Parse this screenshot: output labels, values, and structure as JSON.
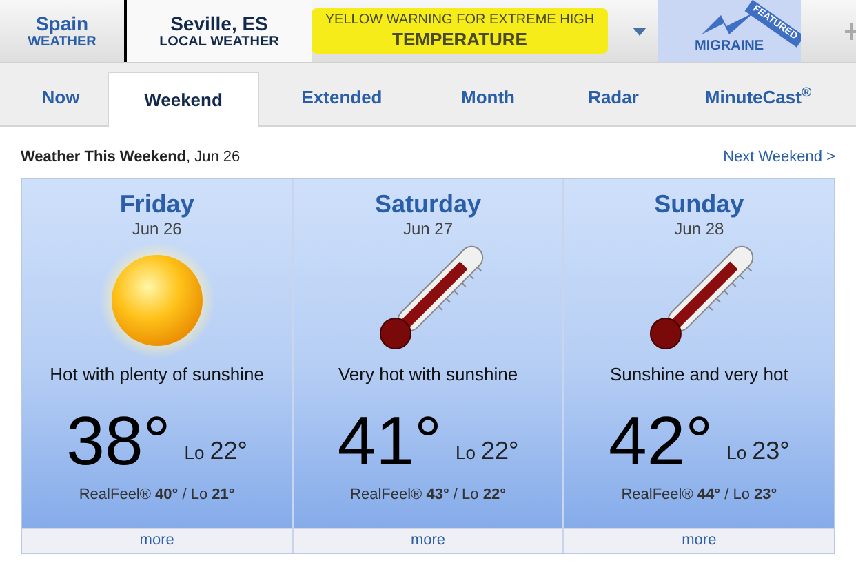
{
  "header": {
    "country": {
      "name": "Spain",
      "sub": "WEATHER"
    },
    "city": {
      "name": "Seville, ES",
      "sub": "LOCAL WEATHER"
    },
    "warning": {
      "line1": "YELLOW WARNING FOR EXTREME HIGH",
      "line2": "TEMPERATURE"
    },
    "featured": {
      "badge": "FEATURED",
      "label": "MIGRAINE"
    }
  },
  "tabs": [
    {
      "label": "Now",
      "selected": false
    },
    {
      "label": "Weekend",
      "selected": true
    },
    {
      "label": "Extended",
      "selected": false
    },
    {
      "label": "Month",
      "selected": false
    },
    {
      "label": "Radar",
      "selected": false
    },
    {
      "label": "MinuteCast$^{®}$",
      "selected": false
    }
  ],
  "section": {
    "title": "Weather This Weekend",
    "date": ", Jun 26",
    "link": "Next Weekend >"
  },
  "days": [
    {
      "name": "Friday",
      "date": "Jun 26",
      "kind": "sun",
      "summary": "Hot with plenty of sunshine",
      "high": "38°",
      "lo_label": "Lo",
      "low": "22°",
      "realfeel": "RealFeel® **40°** / Lo **21°**",
      "more": "more"
    },
    {
      "name": "Saturday",
      "date": "Jun 27",
      "kind": "thermometer",
      "summary": "Very hot with sunshine",
      "high": "41°",
      "lo_label": "Lo",
      "low": "22°",
      "realfeel": "RealFeel® **43°** / Lo **22°**",
      "more": "more"
    },
    {
      "name": "Sunday",
      "date": "Jun 28",
      "kind": "thermometer",
      "summary": "Sunshine and very hot",
      "high": "42°",
      "lo_label": "Lo",
      "low": "23°",
      "realfeel": "RealFeel® **44°** / Lo **23°**",
      "more": "more"
    }
  ]
}
